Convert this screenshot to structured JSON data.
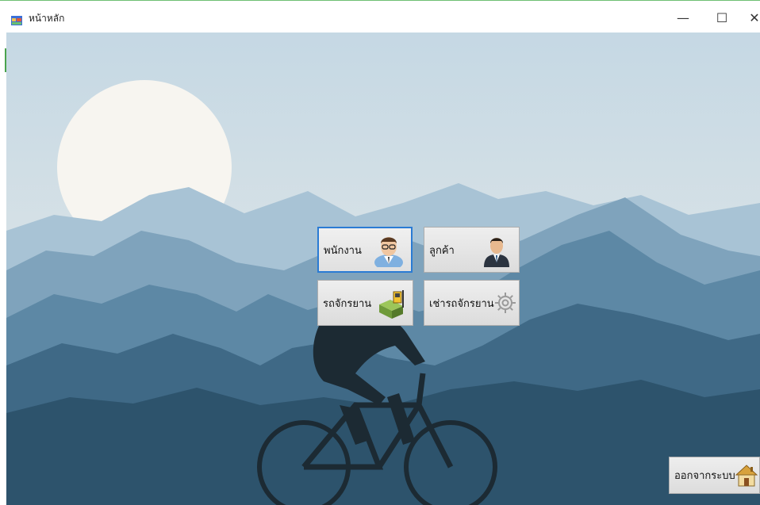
{
  "window": {
    "title": "หน้าหลัก",
    "controls": {
      "minimize": "—",
      "maximize": "☐",
      "close": "✕"
    }
  },
  "menu_buttons": {
    "employee": {
      "label": "พนักงาน",
      "icon": "employee-person-icon"
    },
    "customer": {
      "label": "ลูกค้า",
      "icon": "customer-businessman-icon"
    },
    "bikes": {
      "label": "รถจักรยาน",
      "icon": "forklift-icon"
    },
    "rental": {
      "label": "เช่ารถจักรยาน",
      "icon": "gear-icon"
    }
  },
  "logout_button": {
    "label": "ออกจากระบบ",
    "icon": "home-icon"
  },
  "colors": {
    "sky_top": "#c9dbe6",
    "sky_bottom": "#dfe6e6",
    "mountain_far": "#a6c3d6",
    "mountain_mid": "#6d96b2",
    "mountain_near": "#2b5570",
    "focus_border": "#2a7bd4"
  }
}
